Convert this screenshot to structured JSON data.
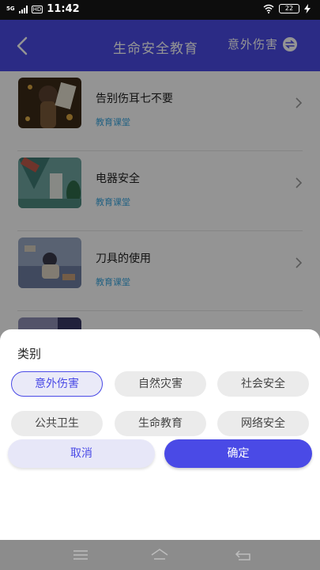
{
  "status_bar": {
    "signal_label": "5G",
    "hd_label": "HD",
    "time": "11:42",
    "battery": "22"
  },
  "header": {
    "title": "生命安全教育",
    "filter_label": "意外伤害"
  },
  "list": [
    {
      "title": "告别伤耳七不要",
      "tag": "教育课堂"
    },
    {
      "title": "电器安全",
      "tag": "教育课堂"
    },
    {
      "title": "刀具的使用",
      "tag": "教育课堂"
    }
  ],
  "sheet": {
    "title": "类别",
    "categories": [
      "意外伤害",
      "自然灾害",
      "社会安全",
      "公共卫生",
      "生命教育",
      "网络安全"
    ],
    "selected": "意外伤害",
    "cancel_label": "取消",
    "confirm_label": "确定"
  },
  "colors": {
    "accent": "#4a4ae6",
    "tag": "#3aa7e0",
    "chip": "#ebebeb"
  }
}
